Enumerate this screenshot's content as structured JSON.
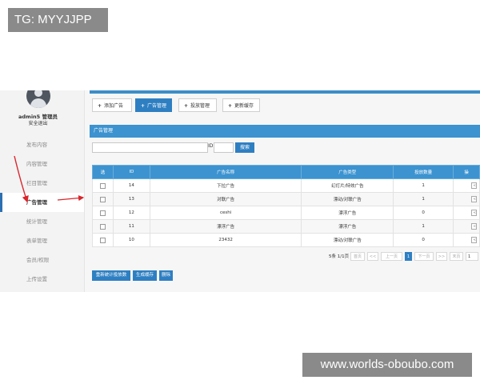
{
  "watermarks": {
    "top": "TG: MYYJJPP",
    "bottom": "www.worlds-oboubo.com"
  },
  "sidebar": {
    "user_name": "admin5 管理员",
    "user_sub": "安全退出",
    "items": [
      {
        "label": "发布内容",
        "active": false
      },
      {
        "label": "内容管理",
        "active": false
      },
      {
        "label": "栏目管理",
        "active": false
      },
      {
        "label": "广告管理",
        "active": true
      },
      {
        "label": "统计管理",
        "active": false
      },
      {
        "label": "表单管理",
        "active": false
      },
      {
        "label": "会员/权限",
        "active": false
      },
      {
        "label": "上传设置",
        "active": false
      }
    ]
  },
  "toolbar": {
    "add_ad": "添加广告",
    "ad_manage": "广告管理",
    "placement_manage": "投放管理",
    "update_cache": "更新缓存"
  },
  "panel": {
    "title": "广告管理"
  },
  "search": {
    "id_label": "ID",
    "button": "搜索"
  },
  "table": {
    "columns": [
      "选",
      "ID",
      "广告名称",
      "广告类型",
      "投放数量",
      "操"
    ],
    "rows": [
      {
        "id": "14",
        "name": "下拉广告",
        "type": "幻灯片/特效广告",
        "count": "1"
      },
      {
        "id": "13",
        "name": "对联广告",
        "type": "漂动/对联广告",
        "count": "1"
      },
      {
        "id": "12",
        "name": "ceshi",
        "type": "漂浮广告",
        "count": "0"
      },
      {
        "id": "11",
        "name": "漂浮广告",
        "type": "漂浮广告",
        "count": "1"
      },
      {
        "id": "10",
        "name": "23432",
        "type": "漂动/对联广告",
        "count": "0"
      }
    ],
    "row_button": "<"
  },
  "pager": {
    "summary": "5条 1/1页",
    "first": "首页",
    "prev2": "<<",
    "prev": "上一页",
    "current": "1",
    "next": "下一页",
    "next2": ">>",
    "last": "末页",
    "page_input": "1"
  },
  "actions": {
    "recount": "重新统计投放数",
    "gen_cache": "生成缓存",
    "delete": "删除"
  },
  "colors": {
    "accent": "#2e7fc2",
    "header_blue": "#3c93d0",
    "arrow_red": "#d9262c",
    "watermark_bg": "#808080"
  }
}
